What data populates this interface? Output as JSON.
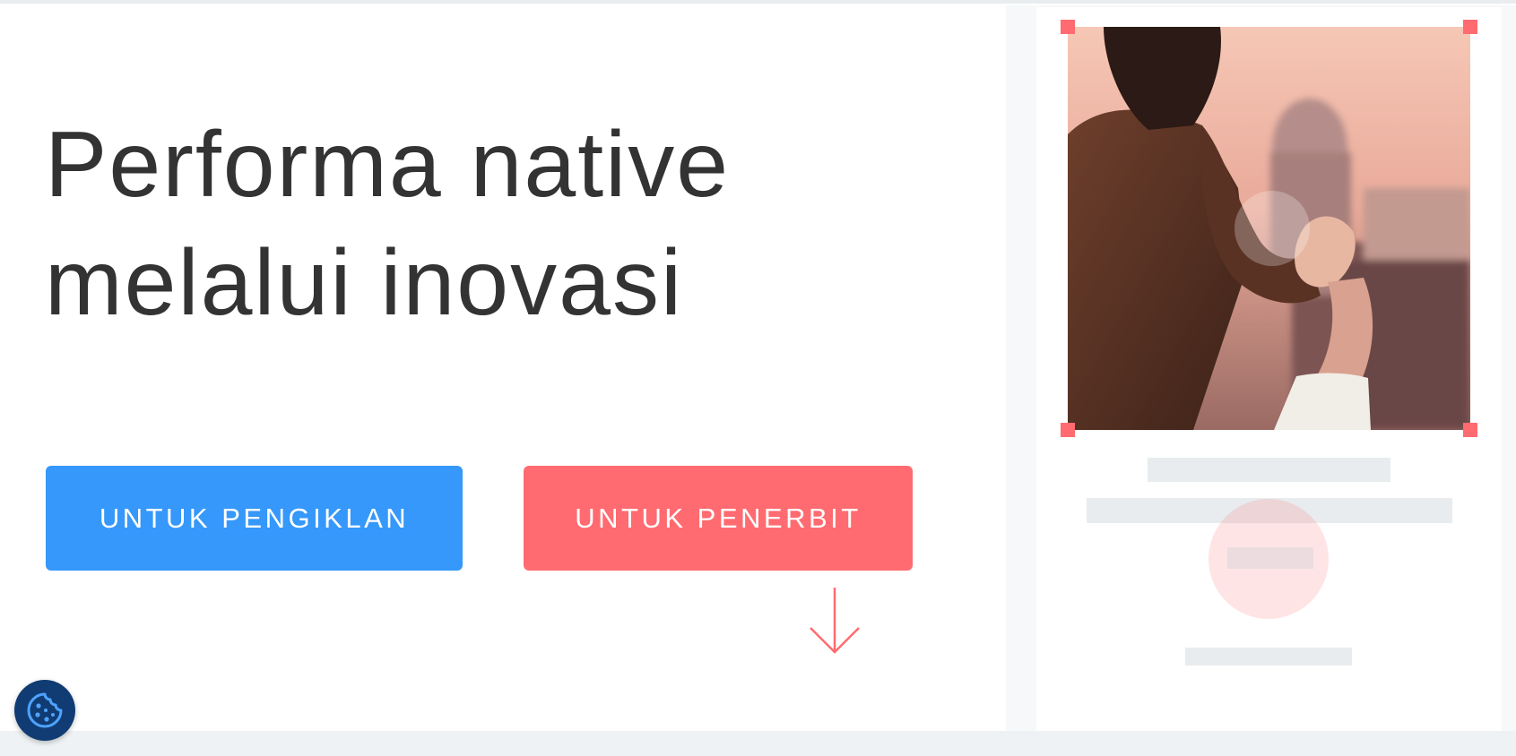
{
  "hero": {
    "title_line1": "Performa native",
    "title_line2": "melalui inovasi"
  },
  "buttons": {
    "advertisers_label": "UNTUK PENGIKLAN",
    "publishers_label": "UNTUK PENERBIT"
  },
  "colors": {
    "advertisers_blue": "#3598fa",
    "publishers_coral": "#ff6b70",
    "title_text": "#333333",
    "cookie_navy": "#103c73"
  },
  "icons": {
    "scroll": "arrow-down-icon",
    "cookie": "cookie-icon"
  }
}
